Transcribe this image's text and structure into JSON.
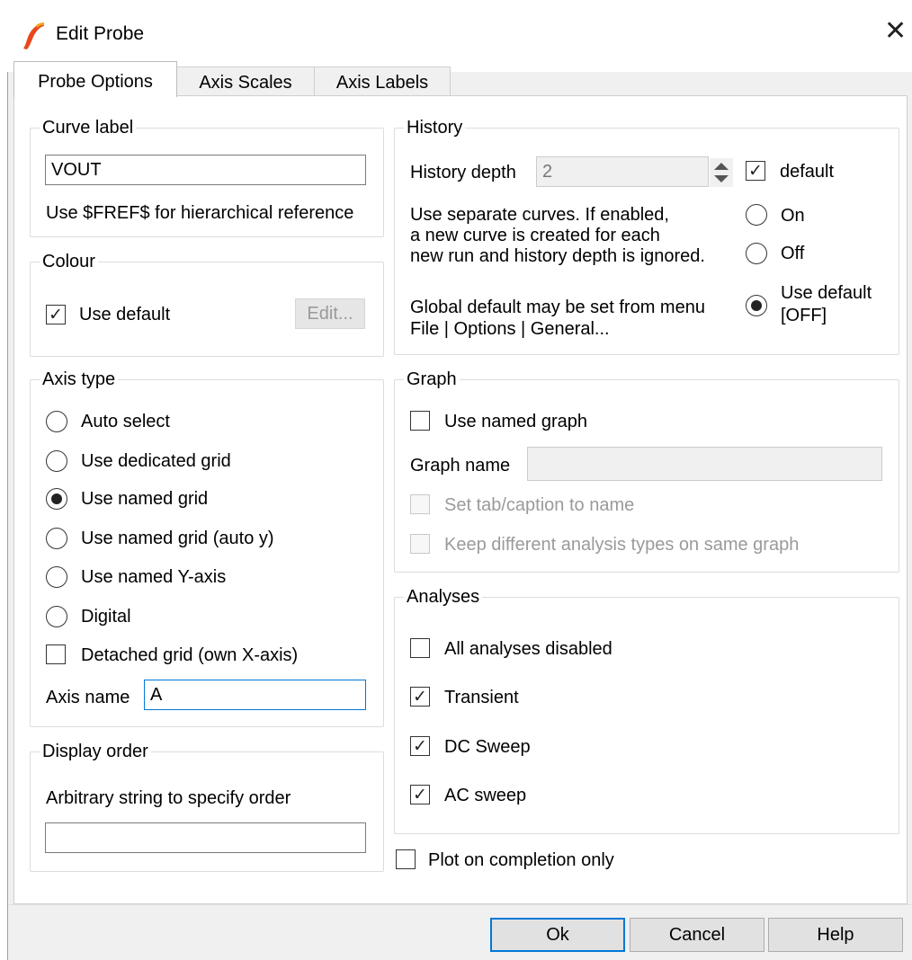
{
  "window": {
    "title": "Edit Probe"
  },
  "tabs": [
    {
      "label": "Probe Options",
      "active": true
    },
    {
      "label": "Axis Scales",
      "active": false
    },
    {
      "label": "Axis Labels",
      "active": false
    }
  ],
  "curve_label": {
    "legend": "Curve label",
    "value": "VOUT",
    "hint": "Use $FREF$ for hierarchical reference"
  },
  "colour": {
    "legend": "Colour",
    "use_default_label": "Use default",
    "use_default_checked": true,
    "edit_button": "Edit..."
  },
  "axis_type": {
    "legend": "Axis type",
    "options": [
      {
        "label": "Auto select",
        "selected": false
      },
      {
        "label": "Use dedicated grid",
        "selected": false
      },
      {
        "label": "Use named grid",
        "selected": true
      },
      {
        "label": "Use named grid (auto y)",
        "selected": false
      },
      {
        "label": "Use named Y-axis",
        "selected": false
      },
      {
        "label": "Digital",
        "selected": false
      }
    ],
    "detached_label": "Detached grid (own X-axis)",
    "detached_checked": false,
    "axis_name_label": "Axis name",
    "axis_name_value": "A"
  },
  "display_order": {
    "legend": "Display order",
    "hint": "Arbitrary string to specify order",
    "value": ""
  },
  "history": {
    "legend": "History",
    "depth_label": "History depth",
    "depth_value": "2",
    "default_label": "default",
    "default_checked": true,
    "separate_line1": "Use separate curves. If enabled,",
    "separate_line2": "a new curve is created for each",
    "separate_line3": "new run and history depth is ignored.",
    "on_label": "On",
    "off_label": "Off",
    "global_line1": "Global default may be set from menu",
    "global_line2": "File | Options | General...",
    "use_default_line1": "Use default",
    "use_default_line2": "[OFF]",
    "selected": "Use default"
  },
  "graph": {
    "legend": "Graph",
    "use_named_label": "Use named graph",
    "use_named_checked": false,
    "graph_name_label": "Graph name",
    "graph_name_value": "",
    "set_tab_label": "Set tab/caption to name",
    "keep_different_label": "Keep different analysis types on same graph"
  },
  "analyses": {
    "legend": "Analyses",
    "items": [
      {
        "label": "All analyses disabled",
        "checked": false
      },
      {
        "label": "Transient",
        "checked": true
      },
      {
        "label": "DC Sweep",
        "checked": true
      },
      {
        "label": "AC sweep",
        "checked": true
      }
    ]
  },
  "plot_on_completion": {
    "label": "Plot on completion only",
    "checked": false
  },
  "buttons": {
    "ok": "Ok",
    "cancel": "Cancel",
    "help": "Help"
  },
  "colors": {
    "accent": "#0078d7",
    "logo": "#e8481c"
  }
}
